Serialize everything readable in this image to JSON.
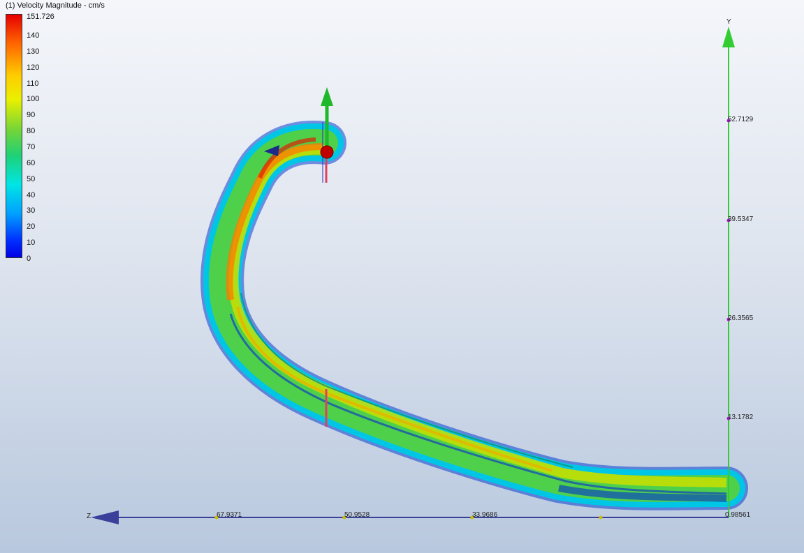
{
  "legend": {
    "title": "(1) Velocity Magnitude - cm/s",
    "max_label": "151.726",
    "ticks": [
      "140",
      "130",
      "120",
      "110",
      "100",
      "90",
      "80",
      "70",
      "60",
      "50",
      "40",
      "30",
      "20",
      "10",
      "0"
    ]
  },
  "y_axis": {
    "name": "Y",
    "ticks": [
      "52.7129",
      "39.5347",
      "26.3565",
      "13.1782"
    ],
    "color": "#33cc33"
  },
  "z_axis": {
    "name": "Z",
    "ticks": [
      "67.9371",
      "50.9528",
      "33.9686"
    ],
    "origin_overlap": "0.98561",
    "color": "#3a3f9a"
  },
  "colors": {
    "high": "#e60000",
    "mid": "#33cc33",
    "low": "#0000e6"
  }
}
